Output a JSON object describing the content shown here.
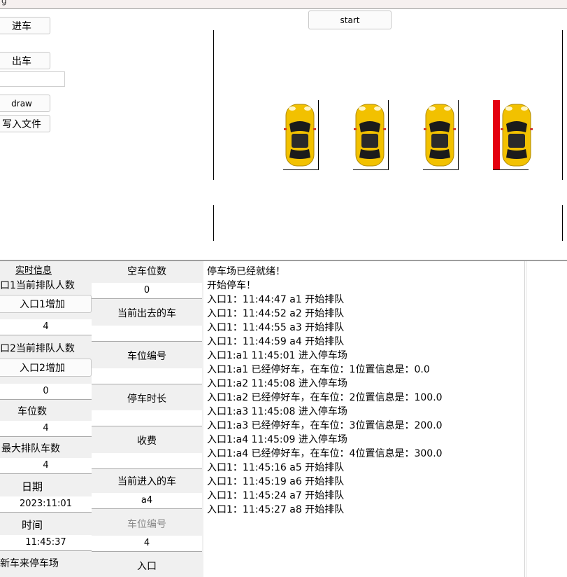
{
  "window": {
    "title": "g"
  },
  "controls": {
    "enter_btn": "进车",
    "exit_btn": "出车",
    "exit_input": "",
    "draw_btn": "draw",
    "write_btn": "写入文件",
    "start_btn": "start"
  },
  "colors": {
    "car_body": "#f4c400",
    "barrier": "#e4000f"
  },
  "left_panel": {
    "realtime_info": "实时信息",
    "entrance1_queue_label": "口1当前排队人数",
    "entrance1_add_btn": "入口1增加",
    "entrance1_queue_value": "4",
    "entrance2_queue_label": "口2当前排队人数",
    "entrance2_add_btn": "入口2增加",
    "entrance2_queue_value": "0",
    "spaces_label": "车位数",
    "spaces_value": "4",
    "max_queue_label": "最大排队车数",
    "max_queue_value": "4",
    "date_label": "日期",
    "date_value": "2023:11:01",
    "time_label": "时间",
    "time_value": "11:45:37",
    "new_car_label": "新车来停车场"
  },
  "mid_panel": {
    "empty_spaces_label": "空车位数",
    "empty_spaces_value": "0",
    "current_leaving_label": "当前出去的车",
    "current_leaving_value": "",
    "space_no_label": "车位编号",
    "space_no_value": "",
    "duration_label": "停车时长",
    "duration_value": "",
    "fee_label": "收费",
    "fee_value": "",
    "current_entering_label": "当前进入的车",
    "current_entering_value": "a4",
    "space_no2_label": "车位编号",
    "space_no2_value": "4",
    "entrance_label": "入口"
  },
  "log": [
    "停车场已经就绪！",
    "开始停车！",
    "入口1：11:44:47 a1 开始排队",
    "入口1：11:44:52 a2 开始排队",
    "入口1：11:44:55 a3 开始排队",
    "入口1：11:44:59 a4 开始排队",
    "入口1:a1 11:45:01 进入停车场",
    "入口1:a1 已经停好车，在车位：1位置信息是：0.0",
    "入口1:a2 11:45:08 进入停车场",
    "入口1:a2 已经停好车，在车位：2位置信息是：100.0",
    "入口1:a3 11:45:08 进入停车场",
    "入口1:a3 已经停好车，在车位：3位置信息是：200.0",
    "入口1:a4 11:45:09 进入停车场",
    "入口1:a4 已经停好车，在车位：4位置信息是：300.0",
    "入口1：11:45:16 a5 开始排队",
    "入口1：11:45:19 a6 开始排队",
    "入口1：11:45:24 a7 开始排队",
    "入口1：11:45:27 a8 开始排队"
  ]
}
